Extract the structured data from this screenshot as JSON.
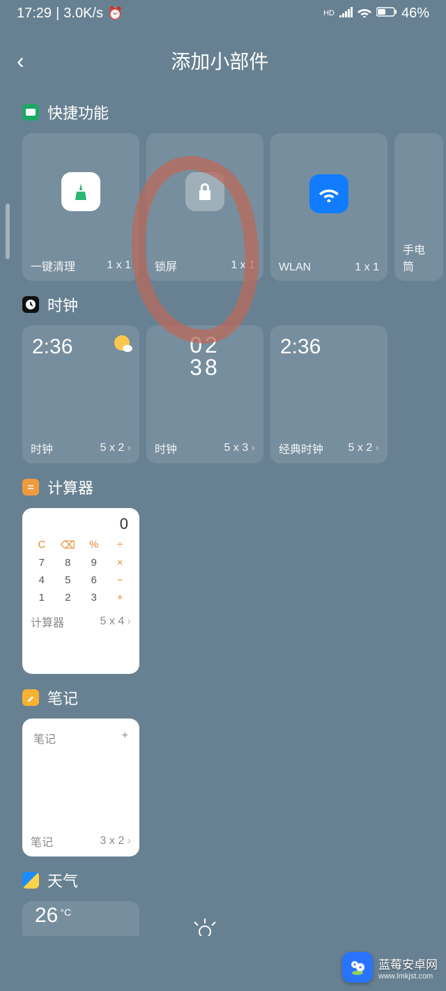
{
  "status": {
    "time": "17:29",
    "speed": "3.0K/s",
    "hd": "HD",
    "battery": "46%"
  },
  "header": {
    "title": "添加小部件"
  },
  "sections": {
    "quick": {
      "title": "快捷功能",
      "items": [
        {
          "label": "一键清理",
          "size": "1 x 1",
          "icon": "broom"
        },
        {
          "label": "锁屏",
          "size": "1 x 1",
          "icon": "lock"
        },
        {
          "label": "WLAN",
          "size": "1 x 1",
          "icon": "wifi"
        },
        {
          "label": "手电筒",
          "size": "",
          "icon": "torch"
        }
      ]
    },
    "clock": {
      "title": "时钟",
      "items": [
        {
          "label": "时钟",
          "size": "5 x 2",
          "time": "2:36"
        },
        {
          "label": "时钟",
          "size": "5 x 3",
          "digital": "02\n38"
        },
        {
          "label": "经典时钟",
          "size": "5 x 2",
          "time": "2:36"
        }
      ]
    },
    "calculator": {
      "title": "计算器",
      "item": {
        "label": "计算器",
        "size": "5 x 4",
        "display": "0"
      },
      "keys": {
        "r1": [
          "C",
          "⌫",
          "%",
          "÷"
        ],
        "r2": [
          "7",
          "8",
          "9",
          "×"
        ],
        "r3": [
          "4",
          "5",
          "6",
          "−"
        ],
        "r4": [
          "1",
          "2",
          "3",
          "+"
        ]
      }
    },
    "notes": {
      "title": "笔记",
      "item": {
        "label": "笔记",
        "size": "3 x 2",
        "inner": "笔记",
        "plus": "+"
      }
    },
    "weather": {
      "title": "天气",
      "temp": "26",
      "unit": "°C"
    }
  },
  "watermark": {
    "name": "蓝莓安卓网",
    "url": "www.lmkjst.com"
  }
}
